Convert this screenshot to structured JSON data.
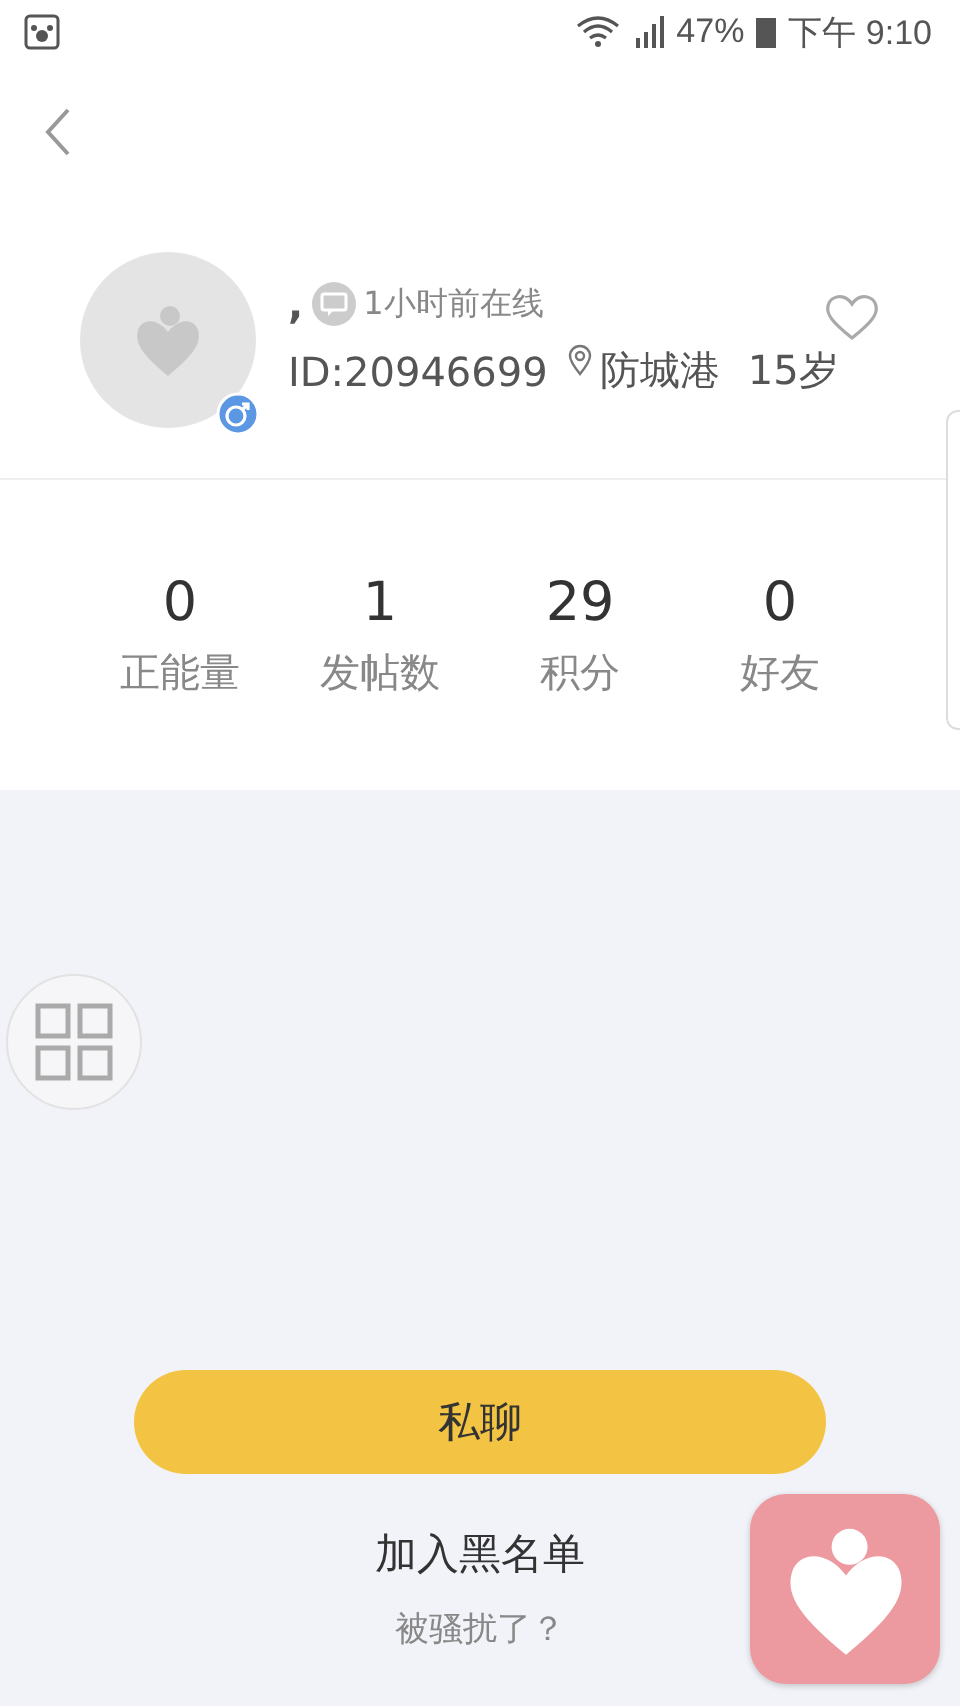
{
  "status_bar": {
    "battery": "47%",
    "time": "下午 9:10"
  },
  "profile": {
    "name": ",",
    "online": "1小时前在线",
    "id": "ID:20946699",
    "city": "防城港",
    "age": "15岁",
    "favorited": false
  },
  "stats": [
    {
      "value": "0",
      "label": "正能量"
    },
    {
      "value": "1",
      "label": "发帖数"
    },
    {
      "value": "29",
      "label": "积分"
    },
    {
      "value": "0",
      "label": "好友"
    }
  ],
  "chat_button": "私聊",
  "blacklist": "加入黑名单",
  "harassed": "被骚扰了？"
}
